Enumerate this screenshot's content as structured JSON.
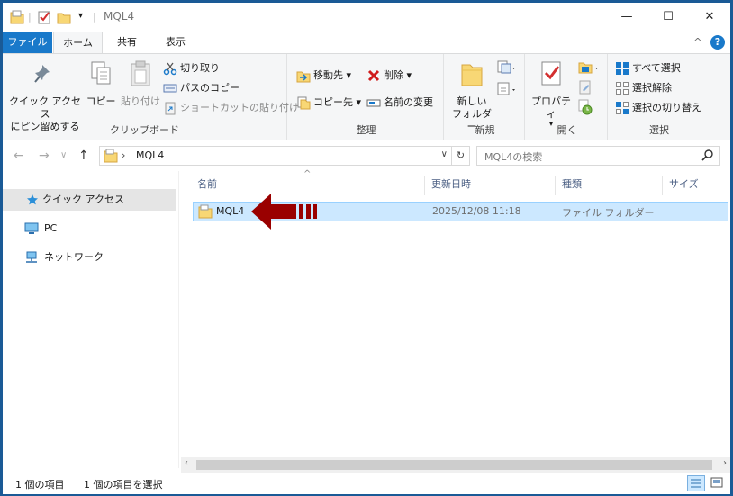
{
  "window": {
    "title": "MQL4",
    "minimize": "—",
    "maximize": "☐",
    "close": "✕"
  },
  "tabs": {
    "file": "ファイル",
    "home": "ホーム",
    "share": "共有",
    "view": "表示",
    "collapse": "^",
    "help": "?"
  },
  "ribbon": {
    "clipboard": {
      "label": "クリップボード",
      "quick_access_line1": "クイック アクセス",
      "quick_access_line2": "にピン留めする",
      "copy": "コピー",
      "paste": "貼り付け",
      "cut": "切り取り",
      "copy_path": "パスのコピー",
      "paste_shortcut": "ショートカットの貼り付け"
    },
    "organize": {
      "label": "整理",
      "move_to": "移動先",
      "copy_to": "コピー先",
      "delete": "削除",
      "rename": "名前の変更"
    },
    "new": {
      "label": "新規",
      "new_folder_line1": "新しい",
      "new_folder_line2": "フォルダー"
    },
    "open": {
      "label": "開く",
      "properties": "プロパティ"
    },
    "select": {
      "label": "選択",
      "select_all": "すべて選択",
      "select_none": "選択解除",
      "invert": "選択の切り替え"
    }
  },
  "address": {
    "path_sep": "›",
    "path": "MQL4",
    "search_placeholder": "MQL4の検索"
  },
  "nav": {
    "quick_access": "クイック アクセス",
    "pc": "PC",
    "network": "ネットワーク"
  },
  "columns": {
    "name": "名前",
    "date": "更新日時",
    "type": "種類",
    "size": "サイズ"
  },
  "files": [
    {
      "name": "MQL4",
      "date": "2025/12/08 11:18",
      "type": "ファイル フォルダー",
      "size": ""
    }
  ],
  "status": {
    "count": "1 個の項目",
    "selected": "1 個の項目を選択"
  },
  "colors": {
    "accent": "#1979ca",
    "selection": "#cce8ff",
    "arrow": "#9a0000",
    "folder": "#f8d775"
  }
}
